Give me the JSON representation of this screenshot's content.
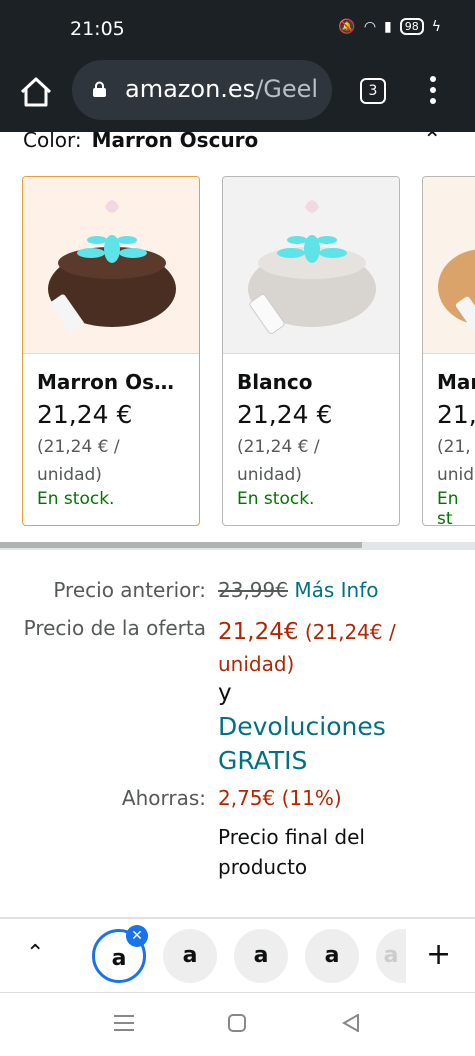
{
  "status": {
    "time": "21:05",
    "battery": "98"
  },
  "browser": {
    "url_domain": "amazon.es",
    "url_path": "/Geel",
    "tab_count": "3"
  },
  "color_label": "Color:",
  "color_value": "Marron Oscuro",
  "swatches": [
    {
      "name": "Marron Osc...",
      "price": "21,24 €",
      "unit_line1": "(21,24 € /",
      "unit_line2": "unidad)",
      "stock": "En stock."
    },
    {
      "name": "Blanco",
      "price": "21,24 €",
      "unit_line1": "(21,24 € /",
      "unit_line2": "unidad)",
      "stock": "En stock."
    },
    {
      "name": "Mar",
      "price": "21,",
      "unit_line1": "(21,",
      "unit_line2": "unid",
      "stock": "En st"
    }
  ],
  "pricing": {
    "prev_label": "Precio anterior:",
    "prev_value": "23,99€",
    "more_info": "Más Info",
    "offer_label": "Precio de la oferta",
    "offer_value": "21,24€",
    "offer_unit": "(21,24€ /",
    "offer_unit2": "unidad)",
    "and": "y",
    "returns_line1": "Devoluciones",
    "returns_line2": "GRATIS",
    "savings_label": "Ahorras:",
    "savings_value": "2,75€ (11%)",
    "final_line1": "Precio final del",
    "final_line2": "producto"
  },
  "tabstrip": {
    "tab_letter": "a"
  },
  "colors": {
    "accent": "#e7a136",
    "price": "#b12704",
    "link": "#007185",
    "stock": "#007600"
  }
}
